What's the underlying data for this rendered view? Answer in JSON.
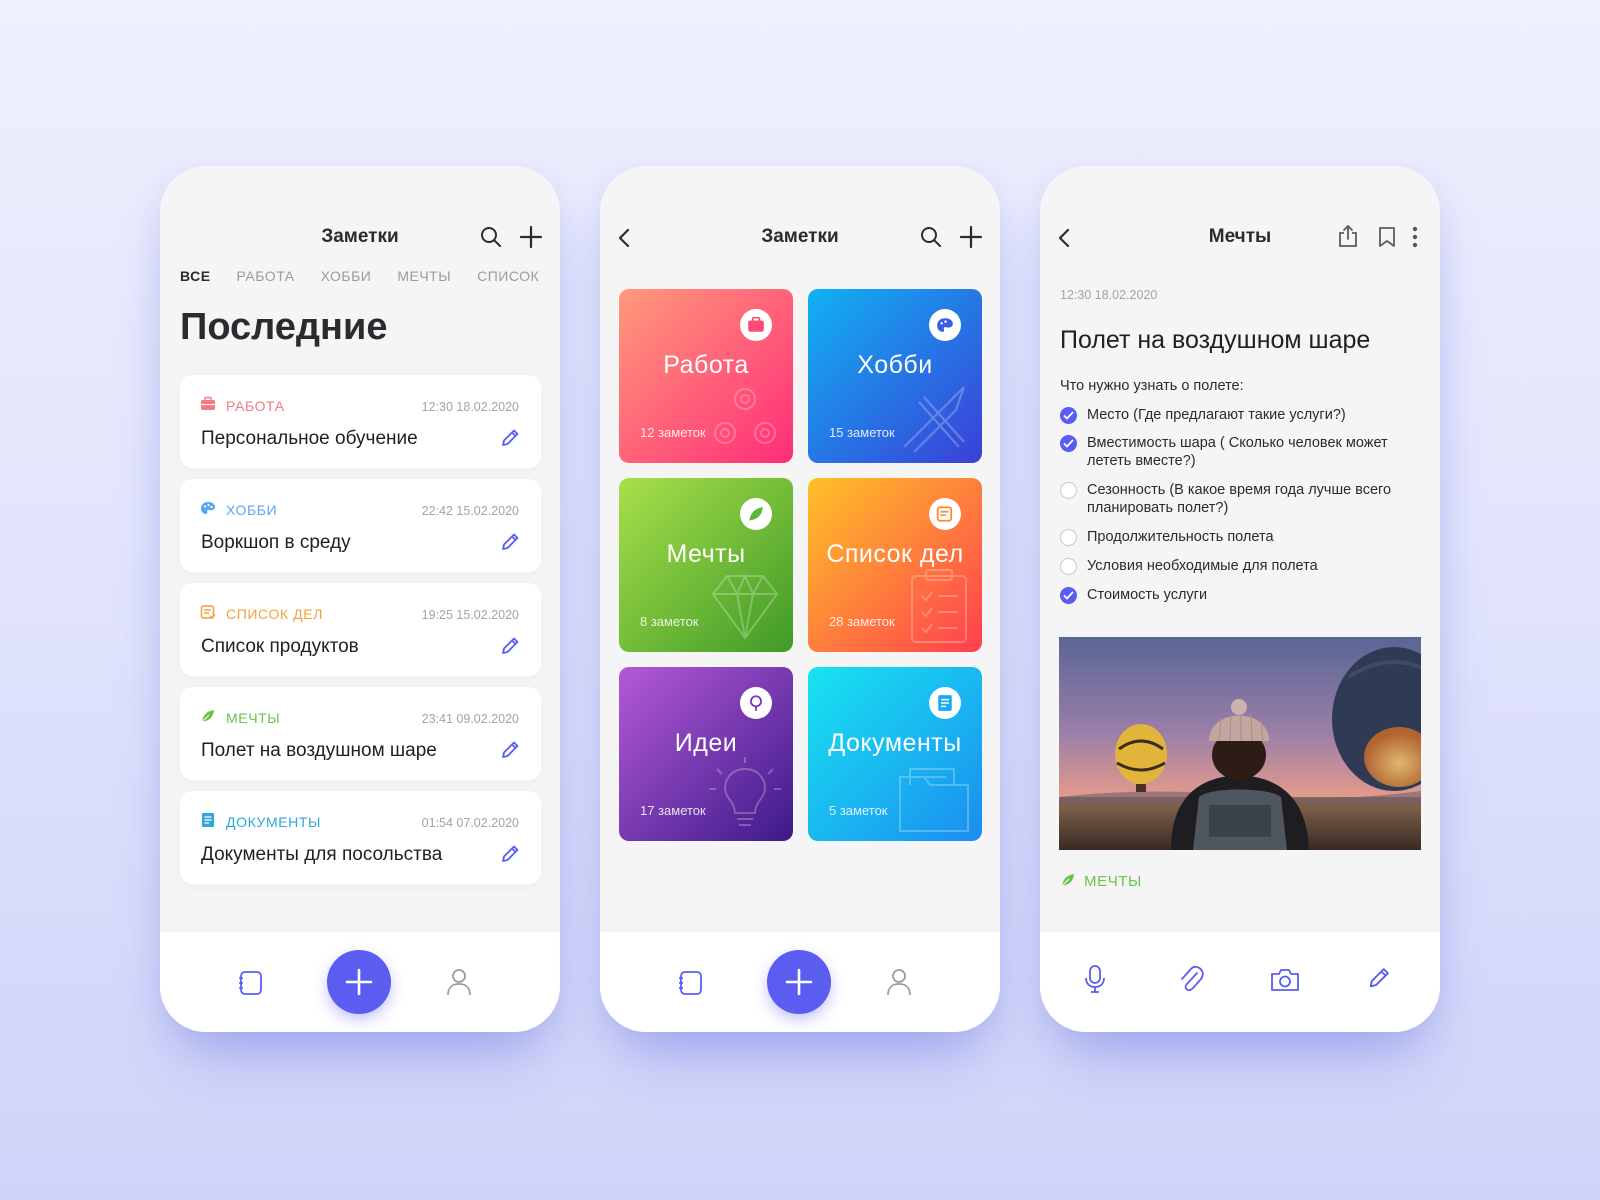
{
  "screen1": {
    "title": "Заметки",
    "tabs": [
      "ВСЕ",
      "РАБОТА",
      "ХОББИ",
      "МЕЧТЫ",
      "СПИСОК"
    ],
    "heading": "Последние",
    "notes": [
      {
        "category": "РАБОТА",
        "color": "#f27a82",
        "icon": "briefcase-icon",
        "date": "12:30 18.02.2020",
        "title": "Персональное обучение"
      },
      {
        "category": "ХОББИ",
        "color": "#5aa7f0",
        "icon": "palette-icon",
        "date": "22:42 15.02.2020",
        "title": "Воркшоп в среду"
      },
      {
        "category": "СПИСОК ДЕЛ",
        "color": "#f4a23c",
        "icon": "checklist-icon",
        "date": "19:25 15.02.2020",
        "title": "Список продуктов"
      },
      {
        "category": "МЕЧТЫ",
        "color": "#6cc34a",
        "icon": "leaf-icon",
        "date": "23:41 09.02.2020",
        "title": "Полет на воздушном шаре"
      },
      {
        "category": "ДОКУМЕНТЫ",
        "color": "#2ea7e0",
        "icon": "document-icon",
        "date": "01:54 07.02.2020",
        "title": "Документы для посольства"
      }
    ]
  },
  "screen2": {
    "title": "Заметки",
    "tiles": [
      {
        "name": "Работа",
        "count": "12 заметок",
        "icon": "briefcase-icon",
        "from": "#ff9a7a",
        "to": "#ff2d78"
      },
      {
        "name": "Хобби",
        "count": "15 заметок",
        "icon": "palette-icon",
        "from": "#0fb2f2",
        "to": "#3b3fd8"
      },
      {
        "name": "Мечты",
        "count": "8 заметок",
        "icon": "leaf-icon",
        "from": "#a8e04a",
        "to": "#3f9a28"
      },
      {
        "name": "Список дел",
        "count": "28 заметок",
        "icon": "checklist-icon",
        "from": "#ffc227",
        "to": "#ff3f4f"
      },
      {
        "name": "Идеи",
        "count": "17 заметок",
        "icon": "bulb-icon",
        "from": "#b45ad6",
        "to": "#3c1a8a"
      },
      {
        "name": "Документы",
        "count": "5 заметок",
        "icon": "document-icon",
        "from": "#18e4f0",
        "to": "#1b8df0"
      }
    ]
  },
  "screen3": {
    "title": "Мечты",
    "date": "12:30 18.02.2020",
    "note_title": "Полет на воздушном шаре",
    "intro": "Что нужно узнать о полете:",
    "checklist": [
      {
        "text": "Место (Где предлагают такие услуги?)",
        "checked": true
      },
      {
        "text": "Вместимость шара ( Сколько человек может лететь вместе?)",
        "checked": true
      },
      {
        "text": "Сезонность (В какое время года лучше всего планировать полет?)",
        "checked": false
      },
      {
        "text": "Продолжительность полета",
        "checked": false
      },
      {
        "text": "Условия необходимые для полета",
        "checked": false
      },
      {
        "text": "Стоимость услуги",
        "checked": true
      }
    ],
    "tag": "МЕЧТЫ",
    "tag_color": "#6cc34a"
  },
  "colors": {
    "accent": "#5b5cf0"
  }
}
